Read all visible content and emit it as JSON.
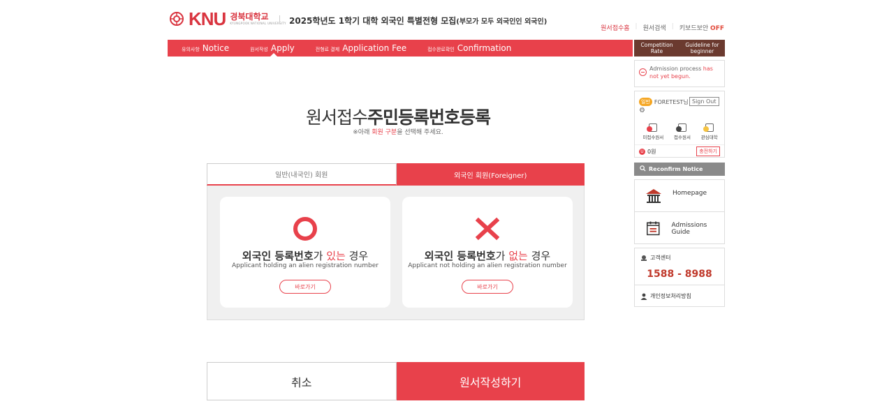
{
  "header": {
    "logo_text": "KNU",
    "logo_kor": "경북대학교",
    "logo_eng": "KYUNGPOOK NATIONAL UNIVERSITY",
    "title": "2025학년도 1학기 대학 외국인 특별전형 모집",
    "title_sub": "(부모가 모두 외국인인 외국인)"
  },
  "util": {
    "home": "원서접수홈",
    "search": "원서검색",
    "keyboard": "키보드보안",
    "keyboard_state": "OFF"
  },
  "nav": [
    {
      "ko": "유의사항",
      "en": "Notice"
    },
    {
      "ko": "원서작성",
      "en": "Apply"
    },
    {
      "ko": "전형료 결제",
      "en": "Application Fee"
    },
    {
      "ko": "접수완료확인",
      "en": "Confirmation"
    }
  ],
  "main": {
    "title_light": "원서접수",
    "title_bold": "주민등록번호등록",
    "sub_a": "※아래 ",
    "sub_red": "회원 구분",
    "sub_b": "을 선택해 주세요.",
    "tab_domestic": "일반(내국인) 회원",
    "tab_foreign": "외국인 회원(Foreigner)",
    "card1": {
      "h1": "외국인 등록번호",
      "h2": "가 ",
      "h3": "있는",
      "h4": " 경우",
      "desc": "Applicant holding an alien registration number",
      "btn": "바로가기"
    },
    "card2": {
      "h1": "외국인 등록번호",
      "h2": "가 ",
      "h3": "없는",
      "h4": " 경우",
      "desc": "Applicant not holding an alien registration number",
      "btn": "바로가기"
    },
    "cancel": "취소",
    "submit": "원서작성하기"
  },
  "sidebar": {
    "competition": "Competition Rate",
    "guideline": "Guideline for beginner",
    "notice_a": "Admission process ",
    "notice_red": "has not yet begun.",
    "badge": "일반",
    "user": "FORETEST님",
    "signout": "Sign Out",
    "icon1": "미접수원서",
    "icon2": "접수원서",
    "icon3": "관심대학",
    "points": "0원",
    "charge": "충전하기",
    "reconfirm": "Reconfirm Notice",
    "homepage": "Homepage",
    "guide": "Admissions Guide",
    "cs_title": "고객센터",
    "phone": "1588 - 8988",
    "privacy": "개인정보처리방침"
  },
  "colors": {
    "accent": "#e8414b",
    "brown": "#6b3a2f"
  }
}
